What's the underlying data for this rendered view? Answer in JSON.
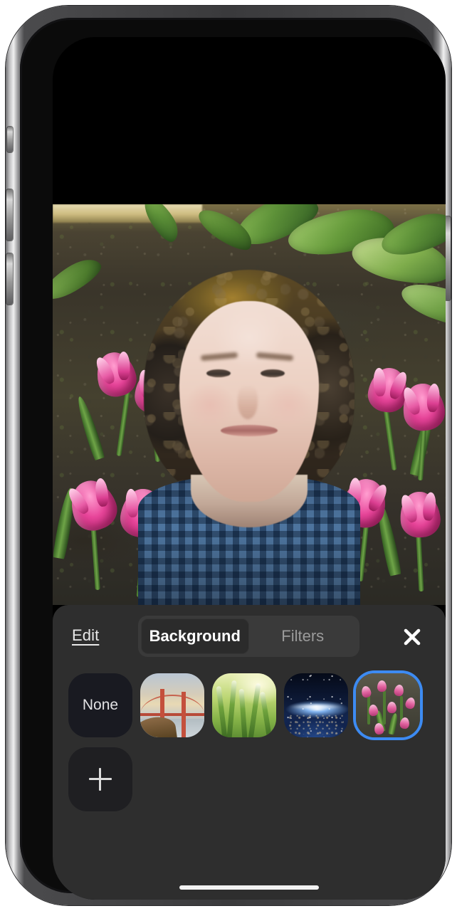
{
  "device": {
    "name": "iphone-frame",
    "hardware": {
      "speaker": "earpiece-speaker",
      "front_camera": "front-camera-lens",
      "camera_in_use_indicator": "green-recording-dot",
      "mute_switch": "mute-switch",
      "volume_up": "volume-up-button",
      "volume_down": "volume-down-button",
      "power": "power-button",
      "home_indicator": "home-indicator-bar"
    }
  },
  "video": {
    "label": "self-view-video-preview",
    "description": "Person with curly hair in blue plaid shirt over a tulip garden virtual background"
  },
  "toolbar": {
    "edit_label": "Edit",
    "close_icon": "close-x-icon",
    "segments": [
      {
        "label": "Background",
        "active": true
      },
      {
        "label": "Filters",
        "active": false
      }
    ]
  },
  "backgrounds": {
    "items": [
      {
        "label": "None",
        "kind": "none",
        "selected": false
      },
      {
        "label": "",
        "kind": "bridge",
        "selected": false
      },
      {
        "label": "",
        "kind": "grass",
        "selected": false
      },
      {
        "label": "",
        "kind": "space",
        "selected": false
      },
      {
        "label": "",
        "kind": "tulips",
        "selected": true
      }
    ],
    "add_label": "",
    "add_icon": "plus-icon"
  },
  "colors": {
    "panel_bg": "#2e2e2e",
    "segment_track": "#3a3a3a",
    "segment_active": "#2b2b2b",
    "selection_ring": "#3d8bf2",
    "text_primary": "#ffffff",
    "text_muted": "#9b9b9b",
    "none_tile": "#191a21",
    "add_tile": "#1f1f22",
    "green_indicator": "#63c464"
  }
}
